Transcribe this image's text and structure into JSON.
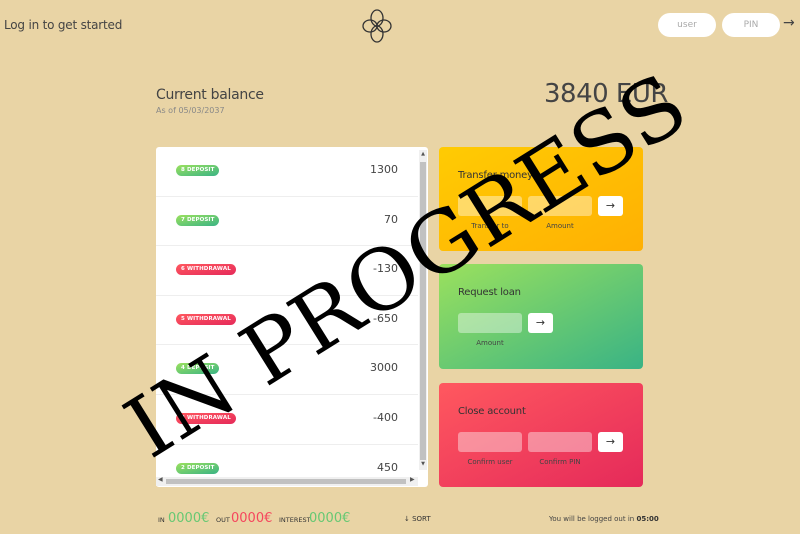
{
  "header": {
    "welcome": "Log in to get started",
    "user_placeholder": "user",
    "pin_placeholder": "PIN",
    "login_arrow": "→"
  },
  "balance": {
    "label": "Current balance",
    "date": "As of 05/03/2037",
    "value": "3840 EUR"
  },
  "movements": [
    {
      "type": "8 DEPOSIT",
      "kind": "deposit",
      "value": "1300"
    },
    {
      "type": "7 DEPOSIT",
      "kind": "deposit",
      "value": "70"
    },
    {
      "type": "6 WITHDRAWAL",
      "kind": "withdrawal",
      "value": "-130"
    },
    {
      "type": "5 WITHDRAWAL",
      "kind": "withdrawal",
      "value": "-650"
    },
    {
      "type": "4 DEPOSIT",
      "kind": "deposit",
      "value": "3000"
    },
    {
      "type": "3 WITHDRAWAL",
      "kind": "withdrawal",
      "value": "-400"
    },
    {
      "type": "2 DEPOSIT",
      "kind": "deposit",
      "value": "450"
    }
  ],
  "operations": {
    "transfer": {
      "title": "Transfer money",
      "label_to": "Transfer to",
      "label_amount": "Amount",
      "button": "→"
    },
    "loan": {
      "title": "Request loan",
      "label_amount": "Amount",
      "button": "→"
    },
    "close": {
      "title": "Close account",
      "label_user": "Confirm user",
      "label_pin": "Confirm PIN",
      "button": "→"
    }
  },
  "summary": {
    "in_label": "In",
    "in_value": "0000€",
    "out_label": "Out",
    "out_value": "0000€",
    "interest_label": "Interest",
    "interest_value": "0000€",
    "sort": "↓ SORT"
  },
  "logout": {
    "text": "You will be logged out in",
    "timer": "05:00"
  },
  "watermark": "IN PROGRESS",
  "colors": {
    "background": "#e9d4a5",
    "deposit": "#66c873",
    "withdrawal": "#f5465d",
    "transfer": "#ffb003",
    "loan": "#39b385",
    "close": "#e52a5a"
  }
}
